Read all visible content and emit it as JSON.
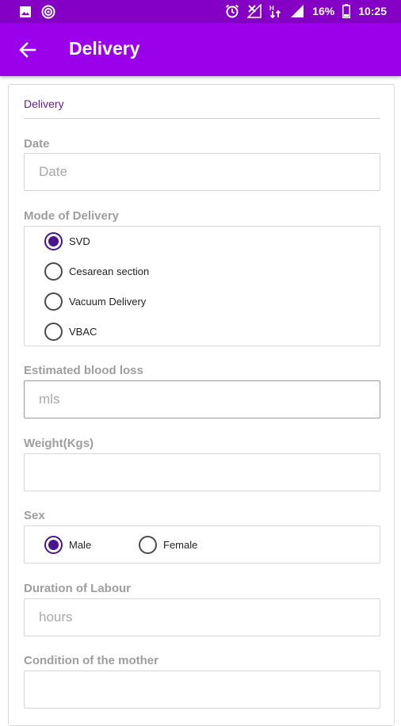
{
  "status_bar": {
    "battery": "16%",
    "time": "10:25",
    "icons": [
      "image-icon",
      "cast-icon",
      "alarm-icon",
      "no-signal-icon",
      "data-arrows-icon",
      "signal-icon",
      "battery-icon"
    ]
  },
  "app_bar": {
    "title": "Delivery",
    "back_icon": "arrow-left-icon"
  },
  "form": {
    "section_title": "Delivery",
    "date": {
      "label": "Date",
      "placeholder": "Date",
      "value": ""
    },
    "mode_of_delivery": {
      "label": "Mode of Delivery",
      "options": [
        "SVD",
        "Cesarean section",
        "Vacuum Delivery",
        "VBAC"
      ],
      "selected": "SVD"
    },
    "blood_loss": {
      "label": "Estimated blood loss",
      "placeholder": "mls",
      "value": ""
    },
    "weight": {
      "label": "Weight(Kgs)",
      "placeholder": "",
      "value": ""
    },
    "sex": {
      "label": "Sex",
      "options": [
        "Male",
        "Female"
      ],
      "selected": "Male"
    },
    "labour_duration": {
      "label": "Duration of Labour",
      "placeholder": "hours",
      "value": ""
    },
    "mother_condition": {
      "label": "Condition of the mother",
      "placeholder": "",
      "value": ""
    }
  },
  "colors": {
    "status_bar": "#8300c4",
    "app_bar": "#9b00ea",
    "accent": "#4a148c",
    "section_title": "#6a1b9a"
  }
}
